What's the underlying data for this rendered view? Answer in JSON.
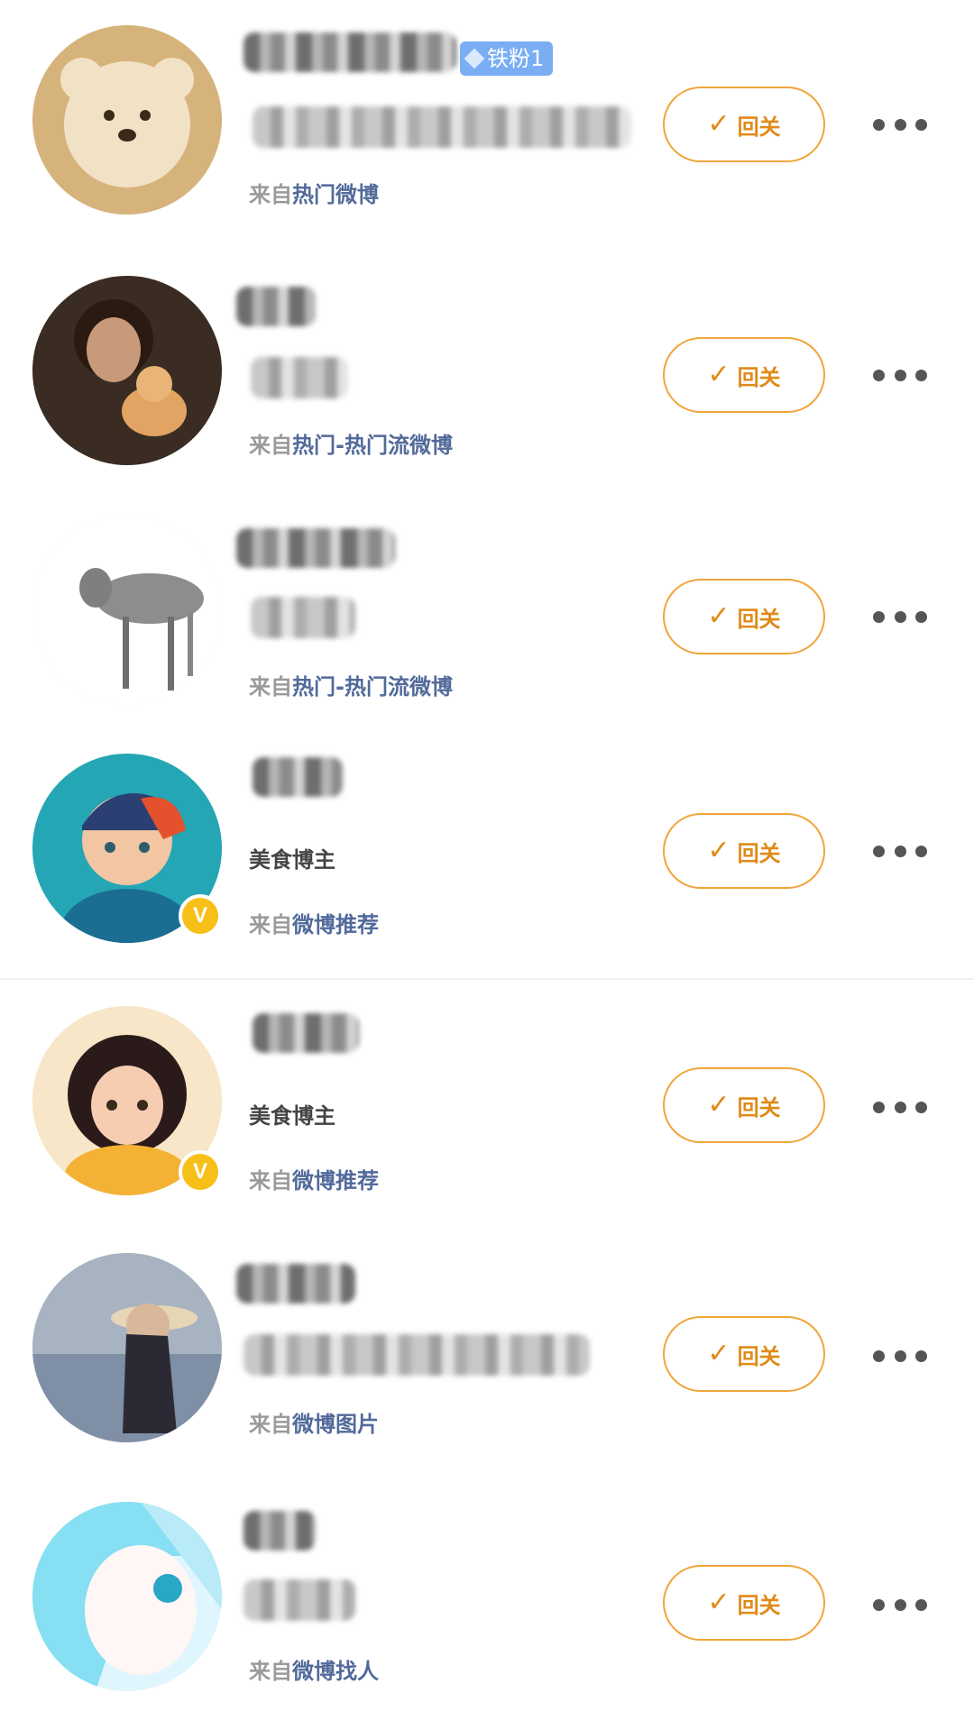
{
  "items": [
    {
      "bio_text": "",
      "source_prefix": "来自",
      "source_origin": "热门微博",
      "tag": "铁粉1",
      "follow_label": "回关",
      "verified": false
    },
    {
      "bio_text": "",
      "source_prefix": "来自",
      "source_origin": "热门-热门流微博",
      "follow_label": "回关",
      "verified": false
    },
    {
      "bio_text": "",
      "source_prefix": "来自",
      "source_origin": "热门-热门流微博",
      "follow_label": "回关",
      "verified": false
    },
    {
      "bio_text": "美食博主",
      "source_prefix": "来自",
      "source_origin": "微博推荐",
      "follow_label": "回关",
      "verified": true
    },
    {
      "bio_text": "美食博主",
      "source_prefix": "来自",
      "source_origin": "微博推荐",
      "follow_label": "回关",
      "verified": true
    },
    {
      "bio_text": "",
      "source_prefix": "来自",
      "source_origin": "微博图片",
      "follow_label": "回关",
      "verified": false
    },
    {
      "bio_text": "",
      "source_prefix": "来自",
      "source_origin": "微博找人",
      "follow_label": "回关",
      "verified": false
    }
  ],
  "icons": {
    "check": "check-icon",
    "more": "more-dots-icon",
    "verified": "verified-v-icon",
    "fan_badge": "diamond-icon"
  },
  "colors": {
    "follow_border": "#f1a53a",
    "source_link": "#526a9a",
    "verified": "#f6c018",
    "fan_badge": "#79aef3"
  },
  "verified_glyph": "V"
}
